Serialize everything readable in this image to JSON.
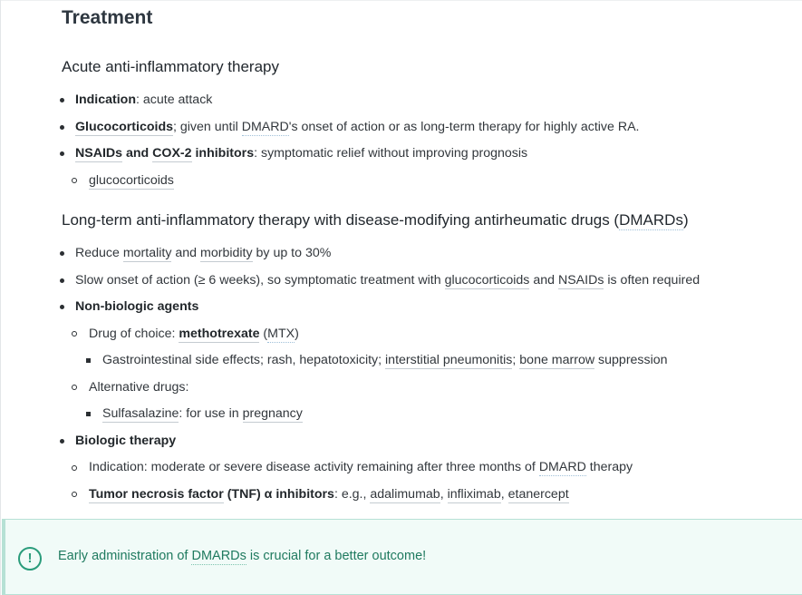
{
  "title": "Treatment",
  "acute": {
    "heading": "Acute anti-inflammatory therapy",
    "items": [
      {
        "bold": "Indication",
        "text": ": acute attack"
      },
      {
        "link": "Glucocorticoids",
        "t1": "; given until ",
        "link2": "DMARD",
        "t2": "'s onset of action or as long-term therapy for highly active RA."
      },
      {
        "link": "NSAIDs",
        "mid": " and ",
        "link2": "COX-2",
        "boldtail": " inhibitors",
        "text": ": symptomatic relief without improving prognosis"
      }
    ],
    "sub": {
      "link": "glucocorticoids"
    }
  },
  "longterm": {
    "heading_pre": "Long-term anti-inflammatory therapy with disease-modifying antirheumatic drugs (",
    "heading_link": "DMARDs",
    "heading_post": ")",
    "reduce": {
      "pre": "Reduce ",
      "l1": "mortality",
      "mid": " and ",
      "l2": "morbidity",
      "post": " by up to 30%"
    },
    "slow": {
      "pre": "Slow onset of action (≥ 6 weeks), so symptomatic treatment with ",
      "l1": "glucocorticoids",
      "mid": " and ",
      "l2": "NSAIDs",
      "post": " is often required"
    },
    "nonbio": "Non-biologic agents",
    "choice": {
      "pre": "Drug of choice: ",
      "l1": "methotrexate",
      "mid": " (",
      "l2": "MTX",
      "post": ")"
    },
    "side": {
      "pre": "Gastrointestinal side effects; rash, hepatotoxicity; ",
      "l1": "interstitial pneumonitis",
      "mid": "; ",
      "l2": "bone marrow",
      "post": " suppression"
    },
    "alt": "Alternative drugs:",
    "sulfa": {
      "l1": "Sulfasalazine",
      "mid": ": for use in ",
      "l2": "pregnancy"
    },
    "bio": "Biologic therapy",
    "bio_ind": {
      "pre": "Indication: moderate or severe disease activity remaining after three months of ",
      "l1": "DMARD",
      "post": " therapy"
    },
    "tnf": {
      "l1": "Tumor necrosis factor",
      "b1": " (TNF) α inhibitors",
      "mid": ": e.g., ",
      "l2": "adalimumab",
      "c1": ", ",
      "l3": "infliximab",
      "c2": ", ",
      "l4": "etanercept"
    }
  },
  "note": {
    "pre": "Early administration of ",
    "link": "DMARDs",
    "post": " is crucial for a better outcome!",
    "icon": "exclamation-icon",
    "color": "#2a9c7b"
  }
}
